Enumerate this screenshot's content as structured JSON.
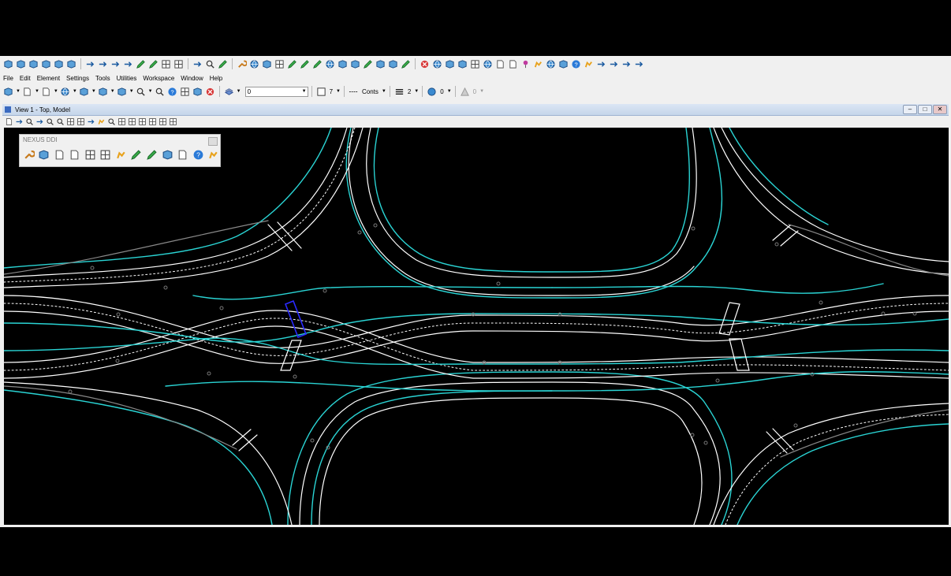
{
  "menu": [
    "File",
    "Edit",
    "Element",
    "Settings",
    "Tools",
    "Utilities",
    "Workspace",
    "Window",
    "Help"
  ],
  "attributes": {
    "active_level": "0",
    "color_index": "7",
    "line_style": "Conts",
    "line_weight": "2",
    "transparency": "0",
    "priority": "0"
  },
  "view": {
    "title": "View 1 - Top, Model",
    "minimize": "–",
    "restore": "□",
    "close": "✕"
  },
  "nexus": {
    "title": "NEXUS DDI"
  },
  "colors": {
    "background": "#000000",
    "road_edge": "#ffffff",
    "curb_line": "#2ad4d4",
    "offset_line": "#4a9a5a",
    "selection": "#2a2aff"
  }
}
